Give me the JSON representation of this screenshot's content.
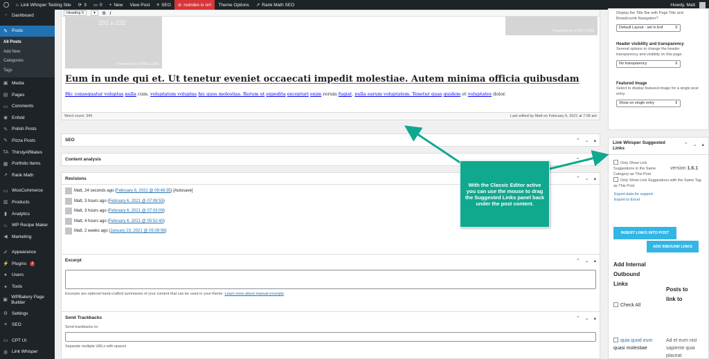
{
  "admin_bar": {
    "site_name": "Link Whisper Testing Site",
    "updates_count": "3",
    "comments_count": "0",
    "new_label": "New",
    "view_post_label": "View Post",
    "seo_label": "SEO",
    "noindex_label": "noindex is on!",
    "theme_options_label": "Theme Options",
    "rank_math_label": "Rank Math SEO",
    "howdy": "Howdy, Matt"
  },
  "sidebar": {
    "items": [
      {
        "label": "Dashboard",
        "icon": "dashboard-icon",
        "glyph": "◔"
      },
      {
        "label": "Posts",
        "icon": "pin-icon",
        "glyph": "✎"
      },
      {
        "label": "Media",
        "icon": "media-icon",
        "glyph": "▣"
      },
      {
        "label": "Pages",
        "icon": "page-icon",
        "glyph": "▤"
      },
      {
        "label": "Comments",
        "icon": "comment-icon",
        "glyph": "▭"
      },
      {
        "label": "Enfold",
        "icon": "enfold-icon",
        "glyph": "◉"
      },
      {
        "label": "Polish Posts",
        "icon": "pin-icon",
        "glyph": "✎"
      },
      {
        "label": "Pizza Posts",
        "icon": "pin-icon",
        "glyph": "✎"
      },
      {
        "label": "ThirstyAffiliates",
        "icon": "ta-icon",
        "glyph": "TA"
      },
      {
        "label": "Portfolio Items",
        "icon": "grid-icon",
        "glyph": "▦"
      },
      {
        "label": "Rank Math",
        "icon": "rank-math-icon",
        "glyph": "↗"
      },
      {
        "label": "WooCommerce",
        "icon": "woo-icon",
        "glyph": "▭"
      },
      {
        "label": "Products",
        "icon": "products-icon",
        "glyph": "▥"
      },
      {
        "label": "Analytics",
        "icon": "analytics-icon",
        "glyph": "▮"
      },
      {
        "label": "WP Recipe Maker",
        "icon": "recipe-icon",
        "glyph": "♨"
      },
      {
        "label": "Marketing",
        "icon": "megaphone-icon",
        "glyph": "◀"
      },
      {
        "label": "Appearance",
        "icon": "brush-icon",
        "glyph": "✐"
      },
      {
        "label": "Plugins",
        "icon": "plugin-icon",
        "glyph": "⚡",
        "badge": "3"
      },
      {
        "label": "Users",
        "icon": "users-icon",
        "glyph": "●"
      },
      {
        "label": "Tools",
        "icon": "wrench-icon",
        "glyph": "✦"
      },
      {
        "label": "WPBakery Page Builder",
        "icon": "wpbakery-icon",
        "glyph": "▣"
      },
      {
        "label": "Settings",
        "icon": "settings-icon",
        "glyph": "⚙"
      },
      {
        "label": "SEO",
        "icon": "seo-icon",
        "glyph": "≡"
      },
      {
        "label": "CPT UI",
        "icon": "cpt-icon",
        "glyph": "▭"
      },
      {
        "label": "Link Whisper",
        "icon": "link-whisper-icon",
        "glyph": "◍"
      }
    ],
    "submenu": [
      "All Posts",
      "Add New",
      "Categories",
      "Tags"
    ]
  },
  "editor": {
    "format_select": "Heading 5",
    "image1_caption": "291 x 232",
    "image_powered": "Powered by HTML.COM",
    "heading_parts": [
      {
        "t": "Eum in unde qui et. Ut tenetur eveniet occaecati impedit molestiae. Autem minima ",
        "link": false
      },
      {
        "t": "officia",
        "link": false
      },
      {
        "t": " ",
        "link": false
      },
      {
        "t": "quibusdam",
        "link": false
      }
    ],
    "paragraph": [
      {
        "t": "Hic consequatur voluptas",
        "link": true
      },
      {
        "t": " ",
        "link": false
      },
      {
        "t": "nulla",
        "link": true
      },
      {
        "t": " cum. ",
        "link": false
      },
      {
        "t": "voluptatem voluptas",
        "link": true
      },
      {
        "t": " ",
        "link": false
      },
      {
        "t": "hic quos molestias. Rerum ut",
        "link": true
      },
      {
        "t": " ",
        "link": false
      },
      {
        "t": "expedita",
        "link": true
      },
      {
        "t": " ",
        "link": false
      },
      {
        "t": "excepturi",
        "link": true
      },
      {
        "t": " ",
        "link": false
      },
      {
        "t": "enim",
        "link": true
      },
      {
        "t": " rerum ",
        "link": false
      },
      {
        "t": "fugiat",
        "link": true
      },
      {
        "t": ". ",
        "link": false
      },
      {
        "t": "nulla earum voluptatem. Tenetur quas",
        "link": true
      },
      {
        "t": " ",
        "link": false
      },
      {
        "t": "quidem",
        "link": true
      },
      {
        "t": " et ",
        "link": false
      },
      {
        "t": "voluptates",
        "link": true
      },
      {
        "t": " dolor.",
        "link": false
      }
    ],
    "word_count": "Word count: 340",
    "last_edited": "Last edited by Matt on February 6, 2021 at 7:09 am"
  },
  "boxes": {
    "seo": "SEO",
    "content_analysis": "Content analysis",
    "revisions": "Revisions",
    "excerpt": "Excerpt",
    "excerpt_help": "Excerpts are optional hand-crafted summaries of your content that can be used in your theme.",
    "excerpt_help_link": "Learn more about manual excerpts",
    "trackbacks": "Send Trackbacks",
    "trackbacks_label": "Send trackbacks to:",
    "trackbacks_help": "Separate multiple URLs with spaces"
  },
  "revisions": [
    {
      "who": "Matt, 24 seconds ago (",
      "link": "February 6, 2021 @ 09:48:35",
      "tail": ") [Autosave]"
    },
    {
      "who": "Matt, 3 hours ago (",
      "link": "February 6, 2021 @ 07:08:55",
      "tail": ")"
    },
    {
      "who": "Matt, 3 hours ago (",
      "link": "February 6, 2021 @ 07:03:09",
      "tail": ")"
    },
    {
      "who": "Matt, 4 hours ago (",
      "link": "February 6, 2021 @ 05:52:40",
      "tail": ")"
    },
    {
      "who": "Matt, 2 weeks ago (",
      "link": "January 23, 2021 @ 05:08:08",
      "tail": ")"
    }
  ],
  "right": {
    "layout_desc": "Display the Title Bar with Page Title and Breadcrumb Navigation?",
    "layout_select": "Default Layout - set in Enf",
    "header_vis_label": "Header visibility and transparency",
    "header_vis_desc": "Several options to change the header transparency and visibility on this page.",
    "header_vis_select": "No transparency",
    "featured_label": "Featured Image",
    "featured_desc": "Select to display featured image for a single post entry.",
    "featured_select": "Show on single entry",
    "lw_title": "Link Whisper Suggested Links",
    "lw_opt1": "Only Show Link Suggestions in the Same Category as This Post",
    "lw_opt2": "Only Show Link Suggestions with the Same Tag as This Post",
    "lw_version_label": "version ",
    "lw_version_num": "1.6.1",
    "export_support": "Export data for support",
    "export_excel": "Export to Excel",
    "insert_btn": "INSERT LINKS INTO POST",
    "inbound_btn": "ADD INBOUND LINKS",
    "add_internal": "Add Internal Outbound Links",
    "check_all": "Check All",
    "posts_to_link": "Posts to link to",
    "sugg_link": "quia quod eum",
    "sugg_text": " quasi molestiae",
    "sugg_target": "Ad et eum nisi sapiente quia placeat"
  },
  "callout": {
    "text": "With the Classic Editor active you can use the mouse to drag the Suggested Links panel back under the post content."
  },
  "colors": {
    "admin_bar": "#1d2327",
    "accent": "#2271b1",
    "callout": "#10a88e",
    "lw_button": "#33b5e5",
    "noindex": "#d63638"
  }
}
